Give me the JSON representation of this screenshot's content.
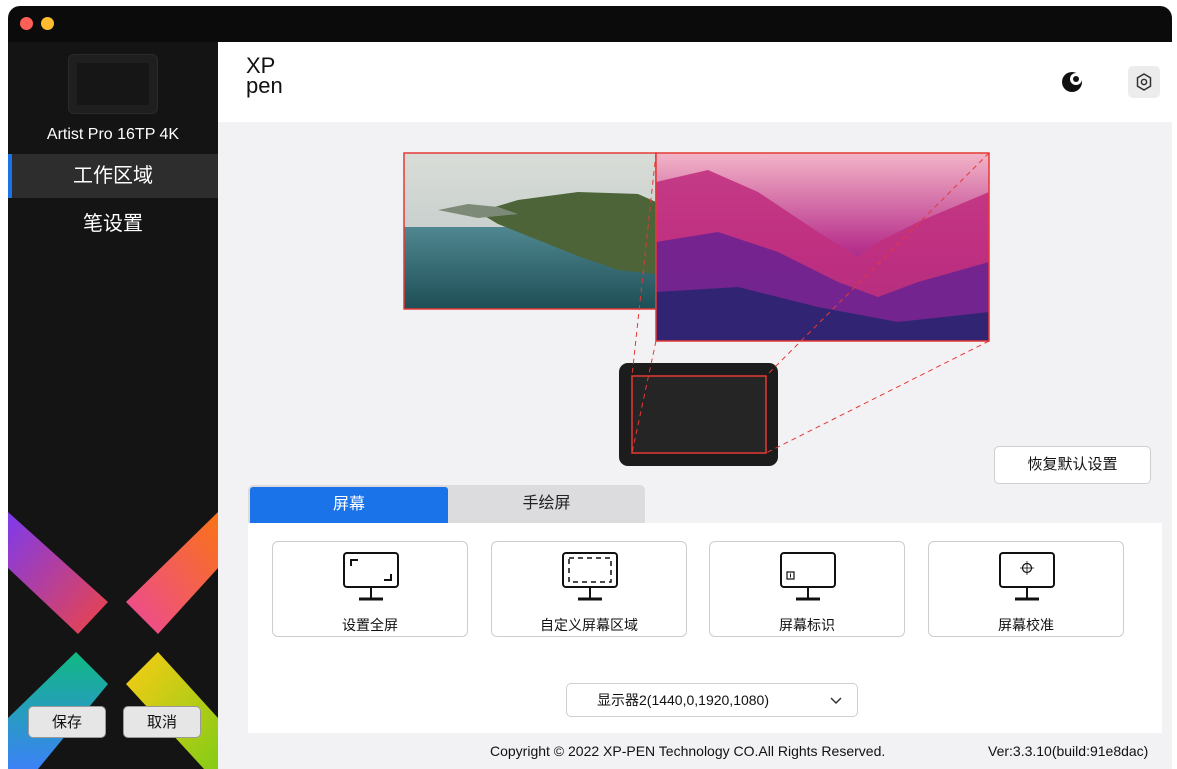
{
  "app": {
    "logo_line1": "XP",
    "logo_line2": "pen",
    "accent_color": "#1a73e8"
  },
  "sidebar": {
    "device_name": "Artist Pro 16TP 4K",
    "nav": [
      {
        "label": "工作区域",
        "active": true
      },
      {
        "label": "笔设置",
        "active": false
      }
    ],
    "save_label": "保存",
    "cancel_label": "取消"
  },
  "header": {
    "theme_icon": "moon-icon",
    "settings_icon": "gear-icon"
  },
  "workarea": {
    "reset_label": "恢复默认设置",
    "tabs": [
      {
        "label": "屏幕",
        "active": true
      },
      {
        "label": "手绘屏",
        "active": false
      }
    ],
    "options": [
      {
        "label": "设置全屏",
        "icon": "fullscreen-monitor-icon"
      },
      {
        "label": "自定义屏幕区域",
        "icon": "custom-area-monitor-icon"
      },
      {
        "label": "屏幕标识",
        "icon": "identify-monitor-icon"
      },
      {
        "label": "屏幕校准",
        "icon": "calibrate-monitor-icon"
      }
    ],
    "display_select": "显示器2(1440,0,1920,1080)"
  },
  "footer": {
    "copyright": "Copyright © 2022  XP-PEN Technology CO.All Rights Reserved.",
    "version": "Ver:3.3.10(build:91e8dac)"
  }
}
